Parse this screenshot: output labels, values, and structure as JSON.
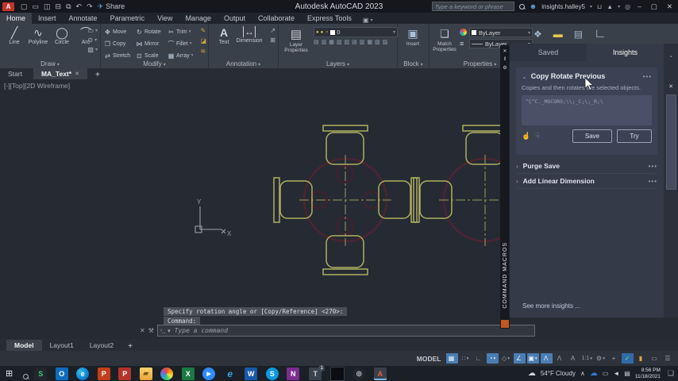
{
  "icons": {
    "dd": "▾",
    "chev_down": "⌄",
    "chev_right": "›",
    "dots": "•••",
    "close": "✕",
    "plus": "+",
    "min": "–",
    "max": "▢",
    "person": "☻",
    "cart": "⊔",
    "adsk": "▲",
    "help": "◎",
    "pause": "‖",
    "gear": "⚙",
    "like": "☝",
    "dislike": "☟",
    "wrench": "⚒",
    "prompt": "›_",
    "pin": "▪",
    "hamburger": "☰"
  },
  "title_bar": {
    "logo": "A",
    "qat_icons": [
      {
        "g": "▢",
        "name": "new"
      },
      {
        "g": "▭",
        "name": "open"
      },
      {
        "g": "◫",
        "name": "save"
      },
      {
        "g": "⊟",
        "name": "plot"
      },
      {
        "g": "⧉",
        "name": "sheet"
      },
      {
        "g": "↶",
        "name": "undo"
      },
      {
        "g": "↷",
        "name": "redo"
      }
    ],
    "share_icon": "✈",
    "share_label": "Share",
    "app_title": "Autodesk AutoCAD 2023",
    "search_placeholder": "Type a keyword or phrase",
    "username": "insights.halley5"
  },
  "ribbon": {
    "tabs": [
      {
        "label": "Home",
        "cls": "active"
      },
      {
        "label": "Insert"
      },
      {
        "label": "Annotate"
      },
      {
        "label": "Parametric"
      },
      {
        "label": "View"
      },
      {
        "label": "Manage"
      },
      {
        "label": "Output"
      },
      {
        "label": "Collaborate"
      },
      {
        "label": "Express Tools"
      }
    ],
    "overflow_glyph": "▣",
    "draw": {
      "label": "Draw",
      "tools": [
        {
          "g": "╱",
          "label": "Line"
        },
        {
          "g": "∿",
          "label": "Polyline"
        },
        {
          "g": "◯",
          "label": "Circle"
        },
        {
          "g": "⌒",
          "label": "Arc"
        }
      ],
      "flyout": [
        {
          "g": "▭"
        },
        {
          "g": "⊙"
        },
        {
          "g": "▨"
        }
      ]
    },
    "modify": {
      "label": "Modify",
      "tools": [
        {
          "g": "✥",
          "label": "Move"
        },
        {
          "g": "❐",
          "label": "Copy"
        },
        {
          "g": "⇄",
          "label": "Stretch"
        },
        {
          "g": "↻",
          "label": "Rotate"
        },
        {
          "g": "⋈",
          "label": "Mirror"
        },
        {
          "g": "⊡",
          "label": "Scale"
        },
        {
          "g": "✂",
          "label": "Trim",
          "dd": "▾"
        },
        {
          "g": "⌒",
          "label": "Fillet",
          "dd": "▾"
        },
        {
          "g": "▦",
          "label": "Array",
          "dd": "▾"
        }
      ],
      "side": [
        {
          "g": "✎"
        },
        {
          "g": "◪"
        },
        {
          "g": "≋"
        }
      ]
    },
    "annotation": {
      "label": "Annotation",
      "text_glyph": "A",
      "text_label": "Text",
      "dim_glyph": "↔",
      "dim_label": "Dimension",
      "side": [
        {
          "g": "↗"
        },
        {
          "g": "⊞"
        }
      ]
    },
    "layers": {
      "label": "Layers",
      "big_glyph": "▤",
      "big_label": "Layer Properties",
      "bulb": "●",
      "lock": "⚬",
      "value": "0",
      "grid": [
        {
          "g": "▤"
        },
        {
          "g": "▥"
        },
        {
          "g": "▦"
        },
        {
          "g": "▧"
        },
        {
          "g": "▨"
        },
        {
          "g": "▤"
        },
        {
          "g": "▥"
        },
        {
          "g": "▦"
        },
        {
          "g": "▧"
        },
        {
          "g": "▨"
        }
      ]
    },
    "block": {
      "label": "Block",
      "big_glyph": "▣",
      "big_label": "Insert"
    },
    "properties": {
      "label": "Properties",
      "big_glyph": "❏",
      "big_label": "Match Properties",
      "color_value": "ByLayer",
      "linetype_value": "ByLayer"
    },
    "extra": [
      {
        "g": "❖",
        "cls": ""
      },
      {
        "g": "▬",
        "cls": "yellow"
      },
      {
        "g": "▤",
        "cls": ""
      },
      {
        "g": "∟",
        "cls": "big"
      }
    ]
  },
  "file_tabs": {
    "items": [
      {
        "label": "Start"
      },
      {
        "label": "MA_Text*",
        "cls": "active",
        "x": "✕"
      }
    ]
  },
  "viewport_label": "[-][Top][2D Wireframe]",
  "macros_strip": {
    "label": "COMMAND MACROS"
  },
  "insights_panel": {
    "tabs": [
      {
        "label": "Saved"
      },
      {
        "label": "Insights",
        "cls": "active"
      }
    ],
    "card": {
      "title": "Copy Rotate Previous",
      "description": "Copies and then rotates the selected objects.",
      "macro": "^C^C._MOCORO;\\\\;_C;\\;_R;\\",
      "save_label": "Save",
      "try_label": "Try"
    },
    "rows": [
      {
        "title": "Purge Save"
      },
      {
        "title": "Add Linear Dimension"
      }
    ],
    "more_link": "See more insights ..."
  },
  "command_line": {
    "history": [
      "Specify rotation angle or [Copy/Reference] <270>:",
      "Command:"
    ],
    "placeholder": "Type a command"
  },
  "layout_tabs": {
    "items": [
      {
        "label": "Model",
        "cls": "active"
      },
      {
        "label": "Layout1"
      },
      {
        "label": "Layout2"
      }
    ]
  },
  "status_bar": {
    "model_label": "MODEL",
    "icons": [
      {
        "g": "▦",
        "cls": "on",
        "name": "grid"
      },
      {
        "g": "∷",
        "dd": "▾",
        "name": "snap"
      },
      {
        "g": "∟",
        "name": "ortho"
      },
      {
        "g": "◔",
        "cls": "on",
        "dd": "▾",
        "name": "polar-tracking"
      },
      {
        "g": "◇",
        "dd": "▾",
        "name": "isometric-drafting"
      },
      {
        "g": "∠",
        "cls": "on",
        "name": "object-snap-tracking"
      },
      {
        "g": "▣",
        "cls": "on",
        "dd": "▾",
        "name": "object-snap"
      },
      {
        "g": "Λ",
        "cls": "on",
        "name": "annotation-visibility"
      },
      {
        "g": "Λ",
        "name": "autoscale"
      },
      {
        "g": "A",
        "name": "annotation-scale"
      },
      {
        "g": "1:1",
        "cls": "txt",
        "dd": "▾",
        "name": "scale-value"
      },
      {
        "g": "⚙",
        "dd": "▾",
        "name": "workspace"
      },
      {
        "g": "+",
        "name": "customize"
      },
      {
        "g": "✓",
        "cls": "perf",
        "name": "graphics-performance"
      },
      {
        "g": "▮",
        "cls": "warn",
        "name": "trusted-autodesk"
      },
      {
        "g": "▭",
        "name": "clean-screen"
      },
      {
        "g": "☰",
        "name": "customization-menu"
      }
    ]
  },
  "taskbar": {
    "start_glyph": "⊞",
    "apps": [
      {
        "g": "S",
        "cls": "sharex"
      },
      {
        "g": "O",
        "cls": "outlook"
      },
      {
        "g": "e",
        "cls": "edge"
      },
      {
        "g": "P",
        "cls": "ppt"
      },
      {
        "g": "P",
        "cls": "paint"
      },
      {
        "g": "▰",
        "cls": "explorer"
      },
      {
        "g": "",
        "cls": "office"
      },
      {
        "g": "X",
        "cls": "excel"
      },
      {
        "g": "▶",
        "cls": "zoomapp"
      },
      {
        "g": "e",
        "cls": "ie"
      },
      {
        "g": "W",
        "cls": "word"
      },
      {
        "g": "S",
        "cls": "skype"
      },
      {
        "g": "N",
        "cls": "onenote"
      }
    ],
    "right_apps": [
      {
        "g": "T",
        "cls": "teams",
        "badge": "1"
      },
      {
        "g": "",
        "cls": "cmdwin"
      },
      {
        "g": "◎",
        "cls": "obs"
      },
      {
        "g": "A",
        "cls": "autocad-active"
      }
    ],
    "tray": {
      "cloud": "☁",
      "weather": "54°F Cloudy",
      "chev": "∧",
      "onedrive": "☁",
      "display": "▭",
      "volume": "◄",
      "input": "▤",
      "time": "8:56 PM",
      "date": "11/18/2021",
      "notif": "❏"
    }
  }
}
